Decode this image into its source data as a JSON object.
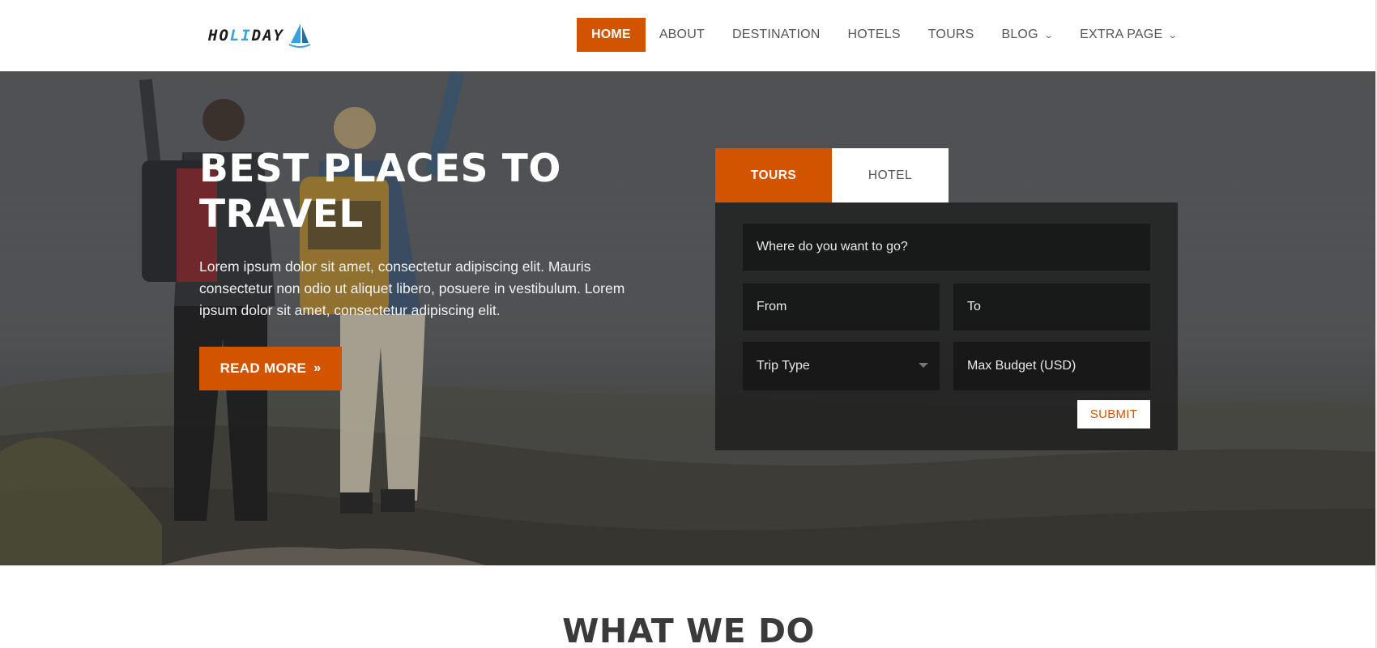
{
  "brand": {
    "logo_prefix": "HO",
    "logo_highlight": "LI",
    "logo_suffix": "DAY",
    "accent": "#d35400",
    "logo_accent": "#3aa1df"
  },
  "nav": {
    "items": [
      {
        "label": "HOME",
        "active": true
      },
      {
        "label": "ABOUT"
      },
      {
        "label": "DESTINATION"
      },
      {
        "label": "HOTELS"
      },
      {
        "label": "TOURS"
      },
      {
        "label": "BLOG",
        "dropdown": true
      },
      {
        "label": "EXTRA PAGE",
        "dropdown": true
      }
    ],
    "dropdown_icon": "chevron-down-icon"
  },
  "hero": {
    "title": "BEST PLACES TO TRAVEL",
    "text": "Lorem ipsum dolor sit amet, consectetur adipiscing elit. Mauris consectetur non odio ut aliquet libero, posuere in vestibulum. Lorem ipsum dolor sit amet, consectetur adipiscing elit.",
    "button_label": "READ MORE",
    "button_icon": "double-chevron-right-icon"
  },
  "search": {
    "tabs": [
      {
        "label": "TOURS",
        "active": true
      },
      {
        "label": "HOTEL"
      }
    ],
    "destination_placeholder": "Where do you want to go?",
    "from_placeholder": "From",
    "to_placeholder": "To",
    "trip_type_selected": "Trip Type",
    "budget_placeholder": "Max Budget (USD)",
    "submit_label": "SUBMIT"
  },
  "section": {
    "title": "WHAT WE DO"
  }
}
